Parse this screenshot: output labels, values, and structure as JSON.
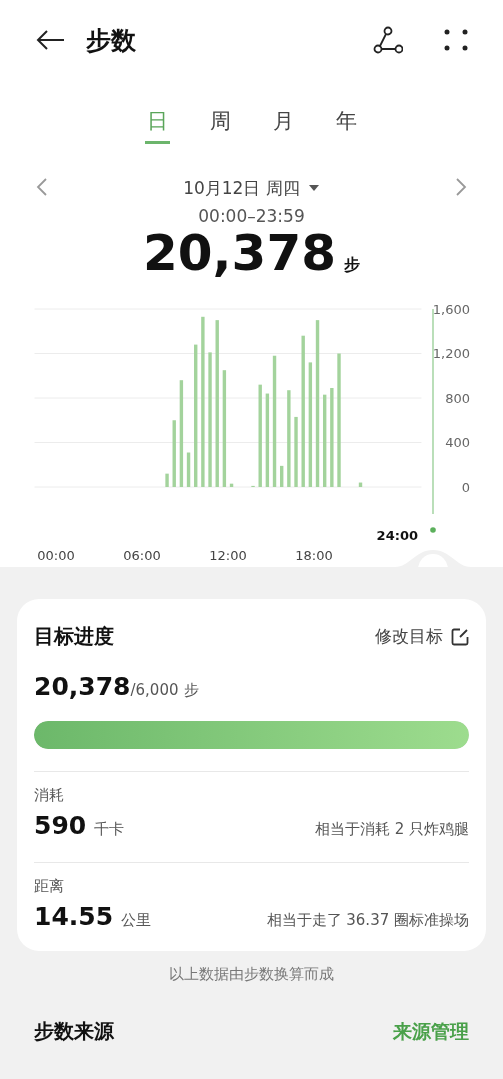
{
  "header": {
    "title": "步数"
  },
  "tabs": [
    {
      "label": "日",
      "selected": true
    },
    {
      "label": "周",
      "selected": false
    },
    {
      "label": "月",
      "selected": false
    },
    {
      "label": "年",
      "selected": false
    }
  ],
  "date": {
    "label": "10月12日 周四"
  },
  "time_range": "00:00–23:59",
  "total": {
    "value": "20,378",
    "unit": "步"
  },
  "chart": {
    "cursor_label": "24:00",
    "chart_data": {
      "type": "bar",
      "grid": true,
      "x": [
        7.75,
        8.25,
        8.75,
        9.25,
        9.75,
        10.25,
        10.75,
        11.25,
        11.75,
        12.25,
        13.75,
        14.25,
        14.75,
        15.25,
        15.75,
        16.25,
        16.75,
        17.25,
        17.75,
        18.25,
        18.75,
        19.25,
        19.75,
        21.25
      ],
      "values": [
        120,
        600,
        960,
        310,
        1280,
        1530,
        1210,
        1500,
        1050,
        30,
        10,
        920,
        840,
        1180,
        190,
        870,
        630,
        1360,
        1120,
        1500,
        830,
        890,
        1200,
        40
      ],
      "xlim": [
        -1.5,
        25.5
      ],
      "ylim": [
        0,
        1600
      ],
      "xticks": [
        {
          "value": 0,
          "label": "00:00"
        },
        {
          "value": 6,
          "label": "06:00"
        },
        {
          "value": 12,
          "label": "12:00"
        },
        {
          "value": 18,
          "label": "18:00"
        }
      ],
      "yticks": [
        {
          "value": 0,
          "label": "0"
        },
        {
          "value": 400,
          "label": "400"
        },
        {
          "value": 800,
          "label": "800"
        },
        {
          "value": 1200,
          "label": "1,200"
        },
        {
          "value": 1600,
          "label": "1,600"
        }
      ]
    }
  },
  "goal": {
    "title": "目标进度",
    "edit_label": "修改目标",
    "current": "20,378",
    "target": "/6,000",
    "unit": "步",
    "level": 1
  },
  "stats": [
    {
      "label": "消耗",
      "value": "590",
      "unit": "千卡",
      "note": "相当于消耗 2 只炸鸡腿"
    },
    {
      "label": "距离",
      "value": "14.55",
      "unit": "公里",
      "note": "相当于走了 36.37 圈标准操场"
    }
  ],
  "footnote": "以上数据由步数换算而成",
  "source": {
    "title": "步数来源",
    "manage_label": "来源管理"
  }
}
